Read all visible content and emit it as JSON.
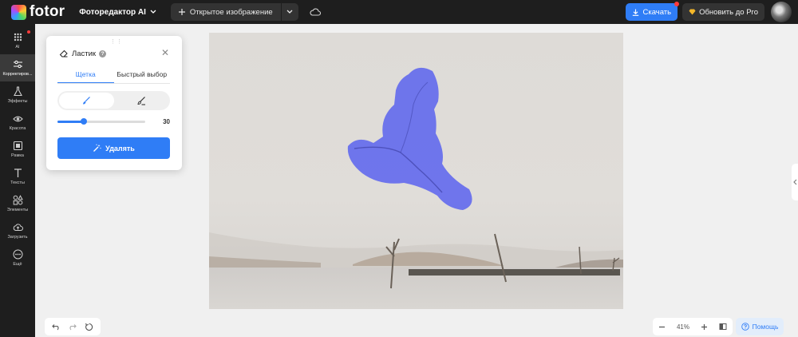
{
  "topbar": {
    "logo_text": "fotor",
    "app_name": "Фоторедактор AI",
    "open_image_label": "Открытое изображение",
    "download_label": "Скачать",
    "upgrade_label": "Обновить до Pro"
  },
  "sidebar": {
    "items": [
      {
        "label": "AI",
        "icon": "ai-grid-icon"
      },
      {
        "label": "Корректиров...",
        "icon": "sliders-icon"
      },
      {
        "label": "Эффекты",
        "icon": "flask-icon"
      },
      {
        "label": "Красота",
        "icon": "eye-icon"
      },
      {
        "label": "Рамка",
        "icon": "frame-icon"
      },
      {
        "label": "Тексты",
        "icon": "text-icon"
      },
      {
        "label": "Элементы",
        "icon": "shapes-icon"
      },
      {
        "label": "Загрузить",
        "icon": "upload-cloud-icon"
      },
      {
        "label": "Ещё",
        "icon": "more-icon"
      }
    ]
  },
  "panel": {
    "title": "Ластик",
    "tabs": [
      "Щетка",
      "Быстрый выбор"
    ],
    "brush_size": "30",
    "brush_size_fraction": 0.3,
    "erase_label": "Удалять"
  },
  "zoom": {
    "level": "41%"
  },
  "help_label": "Помощь",
  "colors": {
    "accent": "#2f7df6",
    "topbar_bg": "#1e1e1e",
    "selection_overlay": "#5b63ee"
  }
}
